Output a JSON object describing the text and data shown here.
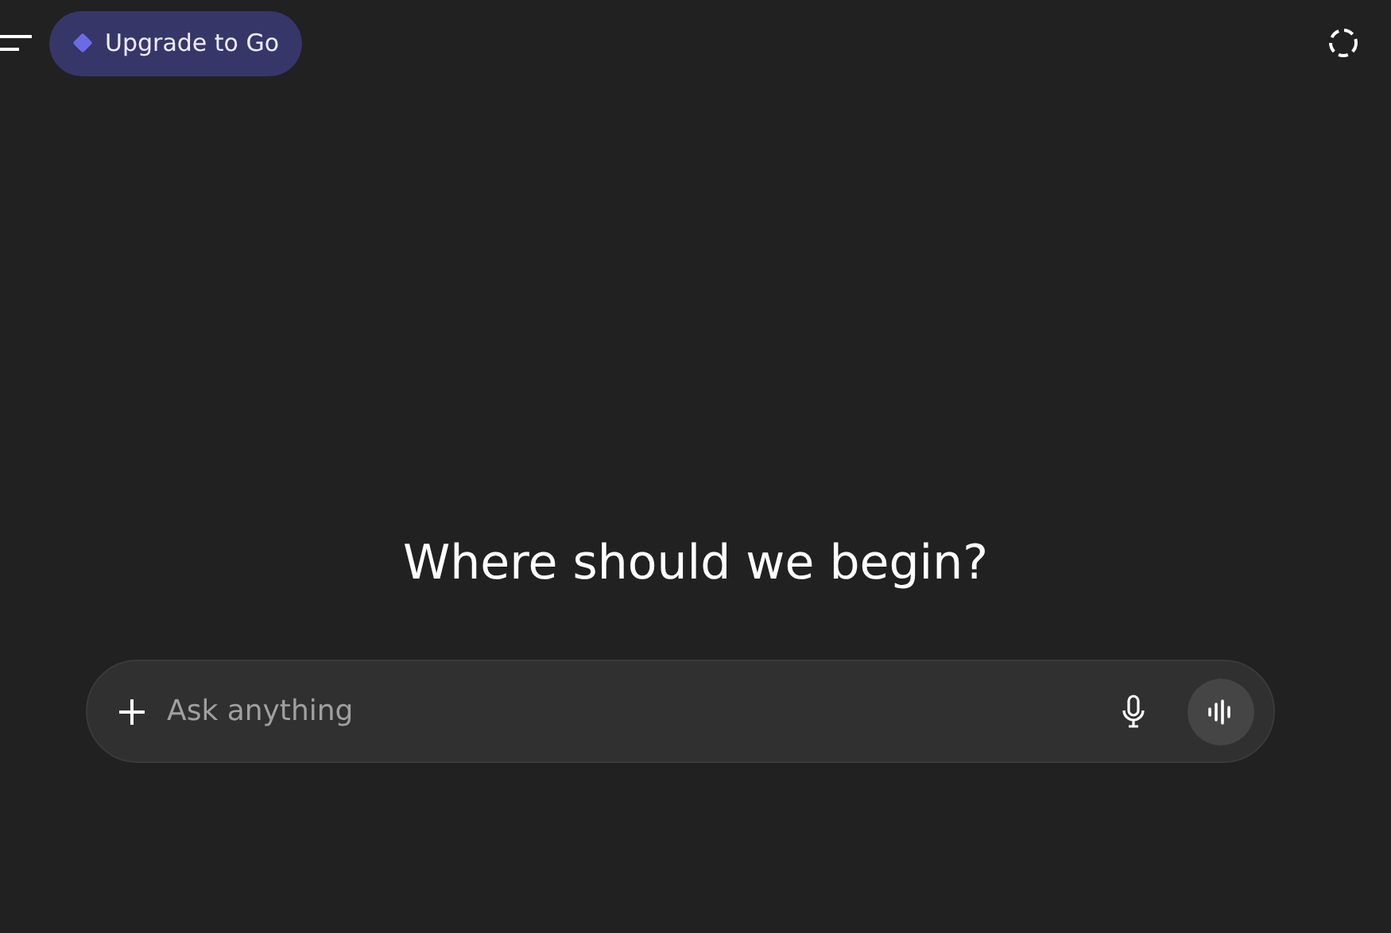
{
  "header": {
    "upgrade_button": "Upgrade to Go"
  },
  "heading": "Where should we begin?",
  "composer": {
    "placeholder": "Ask anything"
  }
}
